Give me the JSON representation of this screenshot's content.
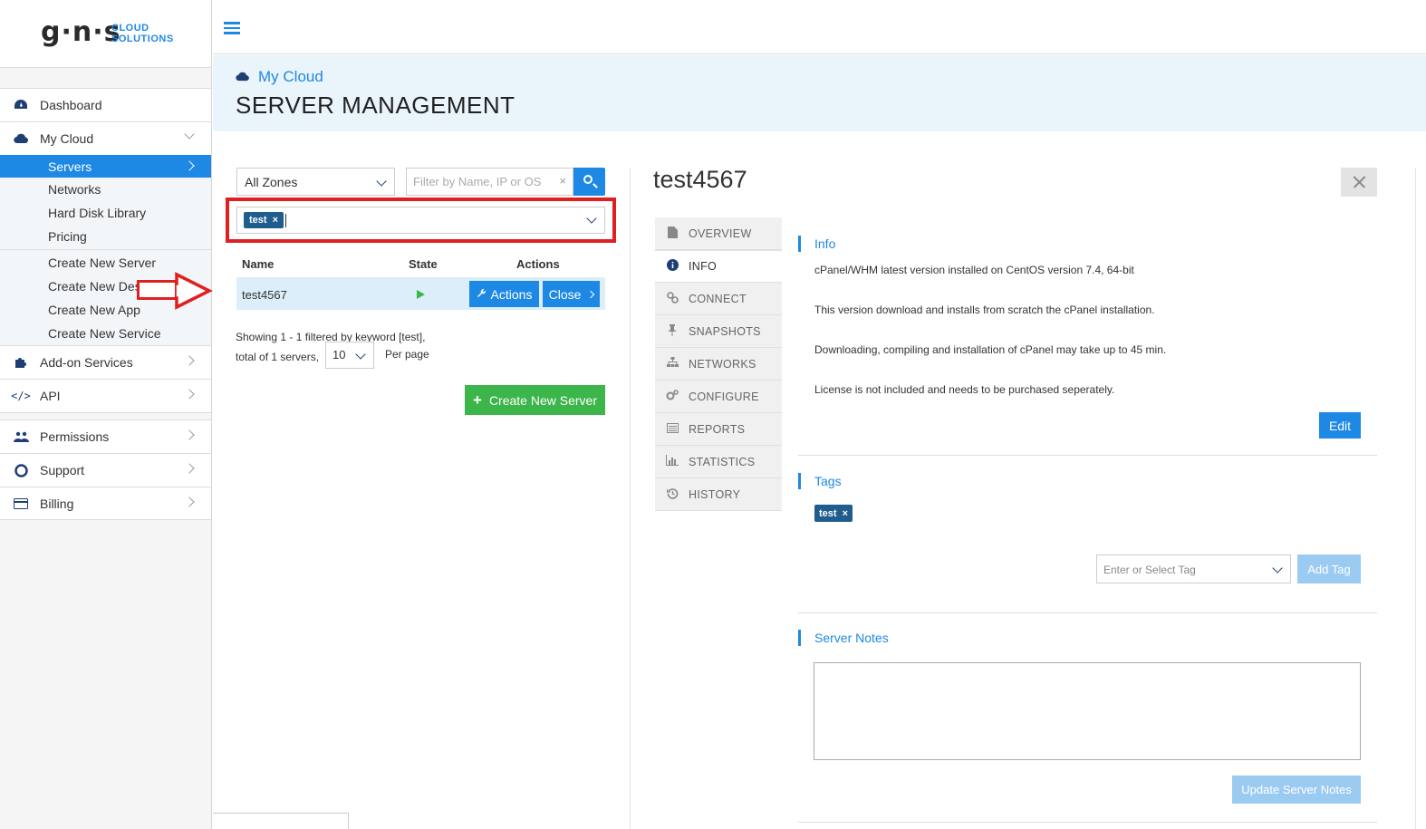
{
  "brand": {
    "logo": "g·n·s",
    "sub1": "CLOUD",
    "sub2": "SOLUTIONS"
  },
  "sidebar": {
    "dashboard": "Dashboard",
    "my_cloud": "My Cloud",
    "sub_items": [
      "Servers",
      "Networks",
      "Hard Disk Library",
      "Pricing"
    ],
    "create_items": [
      "Create New Server",
      "Create New Desktop",
      "Create New App",
      "Create New Service"
    ],
    "addon": "Add-on Services",
    "api": "API",
    "permissions": "Permissions",
    "support": "Support",
    "billing": "Billing"
  },
  "header": {
    "breadcrumb": "My Cloud",
    "title": "SERVER MANAGEMENT"
  },
  "filters": {
    "zone": "All Zones",
    "search_placeholder": "Filter by Name, IP or OS",
    "clear": "×",
    "tag": "test",
    "tag_remove": "×"
  },
  "table": {
    "col_name": "Name",
    "col_state": "State",
    "col_actions": "Actions",
    "row_name": "test4567",
    "actions_btn": "Actions",
    "close_btn": "Close"
  },
  "pagination": {
    "line1": "Showing 1 - 1 filtered by keyword [test],",
    "line2": "total of 1 servers,",
    "per_page_value": "10",
    "per_page_label": "Per page"
  },
  "create_button": "Create New Server",
  "detail": {
    "title": "test4567",
    "tabs": [
      "OVERVIEW",
      "INFO",
      "CONNECT",
      "SNAPSHOTS",
      "NETWORKS",
      "CONFIGURE",
      "REPORTS",
      "STATISTICS",
      "HISTORY"
    ],
    "info_title": "Info",
    "info_lines": [
      "cPanel/WHM latest version installed on CentOS version 7.4, 64-bit",
      "This version download and installs from scratch the cPanel installation.",
      "Downloading, compiling and installation of cPanel may take up to 45 min.",
      "License is not included and needs to be purchased seperately."
    ],
    "edit_btn": "Edit",
    "tags_title": "Tags",
    "tag": "test",
    "tag_remove": "×",
    "tag_placeholder": "Enter or Select Tag",
    "add_tag_btn": "Add Tag",
    "notes_title": "Server Notes",
    "update_notes_btn": "Update Server Notes"
  },
  "colors": {
    "primary": "#1e88e5",
    "success": "#3cb54a",
    "header_bg": "#eaf4fb",
    "highlight": "#e02020",
    "tag": "#1f5d8e"
  },
  "icons": {
    "dashboard": "dashboard-icon",
    "cloud": "cloud-icon",
    "addon": "puzzle-icon",
    "api": "code-icon",
    "permissions": "users-icon",
    "support": "lifebuoy-icon",
    "billing": "credit-card-icon",
    "tabs": [
      "file-icon",
      "info-icon",
      "link-icon",
      "pin-icon",
      "sitemap-icon",
      "gears-icon",
      "list-icon",
      "bar-chart-icon",
      "history-icon"
    ]
  }
}
